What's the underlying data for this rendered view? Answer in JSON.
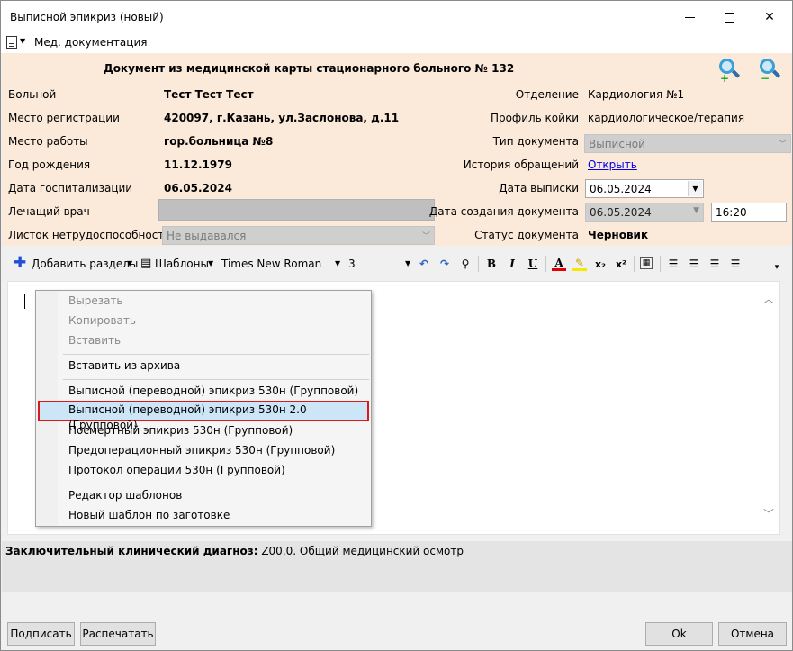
{
  "window": {
    "title": "Выписной эпикриз (новый)"
  },
  "menu": {
    "med_docs": "Мед. документация"
  },
  "header": {
    "heading": "Документ из медицинской карты стационарного больного №  132"
  },
  "patient": {
    "patient_label": "Больной",
    "patient_value": "Тест Тест Тест",
    "reg_label": "Место регистрации",
    "reg_value": "420097, г.Казань, ул.Заслонова, д.11",
    "work_label": "Место работы",
    "work_value": "гор.больница №8",
    "birth_label": "Год рождения",
    "birth_value": "11.12.1979",
    "hosp_label": "Дата госпитализации",
    "hosp_value": "06.05.2024",
    "doctor_label": "Лечащий врач",
    "sick_label": "Листок нетрудоспособности",
    "sick_value": "Не выдавался"
  },
  "document": {
    "dept_label": "Отделение",
    "dept_value": "Кардиология №1",
    "bed_label": "Профиль койки",
    "bed_value": "кардиологическое/терапия",
    "type_label": "Тип документа",
    "type_value": "Выписной",
    "history_label": "История обращений",
    "history_link": "Открыть",
    "discharge_label": "Дата выписки",
    "discharge_value": "06.05.2024",
    "created_label": "Дата создания документа",
    "created_date": "06.05.2024",
    "created_time": "16:20",
    "status_label": "Статус документа",
    "status_value": "Черновик"
  },
  "toolbar": {
    "add_sections": "Добавить разделы",
    "templates": "Шаблоны",
    "font_name": "Times New Roman",
    "font_size": "3",
    "bold": "B",
    "italic": "I",
    "underline": "U",
    "font_color": "A",
    "subscript": "x₂",
    "superscript": "x²"
  },
  "context_menu": {
    "items": [
      {
        "label": "Вырезать",
        "disabled": true
      },
      {
        "label": "Копировать",
        "disabled": true
      },
      {
        "label": "Вставить",
        "disabled": true
      },
      {
        "label": "Вставить из архива",
        "disabled": false
      },
      {
        "label": "Выписной (переводной) эпикриз 530н (Групповой)",
        "disabled": false
      },
      {
        "label": "Выписной (переводной) эпикриз 530н 2.0 (Групповой)",
        "disabled": false,
        "selected": true
      },
      {
        "label": "Посмертный эпикриз 530н (Групповой)",
        "disabled": false
      },
      {
        "label": "Предоперационный эпикриз 530н (Групповой)",
        "disabled": false
      },
      {
        "label": "Протокол операции 530н (Групповой)",
        "disabled": false
      },
      {
        "label": "Редактор шаблонов",
        "disabled": false
      },
      {
        "label": "Новый шаблон по заготовке",
        "disabled": false
      }
    ]
  },
  "diagnosis": {
    "label": "Заключительный клинический диагноз:",
    "value": " Z00.0. Общий медицинский осмотр"
  },
  "buttons": {
    "sign": "Подписать",
    "print": "Распечатать",
    "ok": "Ok",
    "cancel": "Отмена"
  },
  "colors": {
    "info_panel_bg": "#fbe9d9",
    "selection_border": "#e0161a",
    "selection_bg": "#cde6f7",
    "link": "#0000ee"
  }
}
